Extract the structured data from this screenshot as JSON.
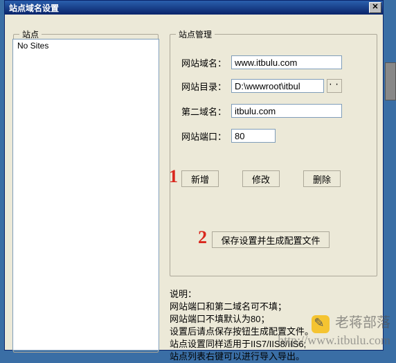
{
  "window": {
    "title": "站点域名设置",
    "close_glyph": "✕"
  },
  "sites_group": {
    "legend": "站点",
    "items": [
      "No Sites"
    ]
  },
  "mgmt_group": {
    "legend": "站点管理",
    "fields": {
      "domain": {
        "label": "网站域名：",
        "value": "www.itbulu.com"
      },
      "dir": {
        "label": "网站目录：",
        "value": "D:\\wwwroot\\itbul",
        "browse_glyph": "··"
      },
      "alt": {
        "label": "第二域名：",
        "value": "itbulu.com"
      },
      "port": {
        "label": "网站端口：",
        "value": "80"
      }
    },
    "buttons": {
      "add": "新增",
      "edit": "修改",
      "del": "删除",
      "save": "保存设置并生成配置文件"
    }
  },
  "annotations": {
    "step1": "1",
    "step2": "2"
  },
  "info": {
    "heading": "说明：",
    "lines": [
      "网站端口和第二域名可不填；",
      "网站端口不填默认为80；",
      "设置后请点保存按钮生成配置文件。",
      "站点设置同样适用于IIS7/IIS8/IIS6;",
      "站点列表右键可以进行导入导出。"
    ]
  },
  "watermark": {
    "zh": "老蒋部落",
    "url": "http://www.itbulu.com"
  }
}
